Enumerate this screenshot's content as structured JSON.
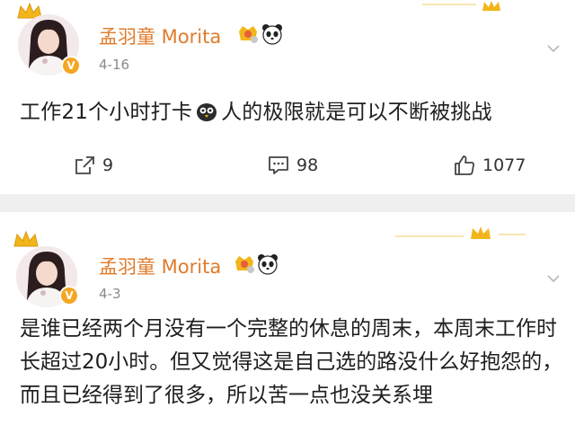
{
  "posts": [
    {
      "author": "孟羽童 Morita",
      "date": "4-16",
      "verified_badge": "V",
      "text_before_emoji": "工作21个小时打卡",
      "text_after_emoji": "人的极限就是可以不断被挑战",
      "actions": {
        "repost_count": "9",
        "comment_count": "98",
        "like_count": "1077"
      }
    },
    {
      "author": "孟羽童 Morita",
      "date": "4-3",
      "verified_badge": "V",
      "text": "是谁已经两个月没有一个完整的休息的周末，本周末工作时长超过20小时。但又觉得这是自己选的路没什么好抱怨的，而且已经得到了很多，所以苦一点也没关系埋"
    }
  ],
  "colors": {
    "name": "#e07b2a",
    "crown": "#f2b51a",
    "badge": "#f5a623",
    "separator": "#efefef"
  },
  "icons": [
    "crown-icon",
    "level-badge-icon",
    "panda-emoji-icon",
    "owl-emoji-icon",
    "repost-icon",
    "comment-icon",
    "like-icon",
    "dropdown-chevron-icon"
  ]
}
